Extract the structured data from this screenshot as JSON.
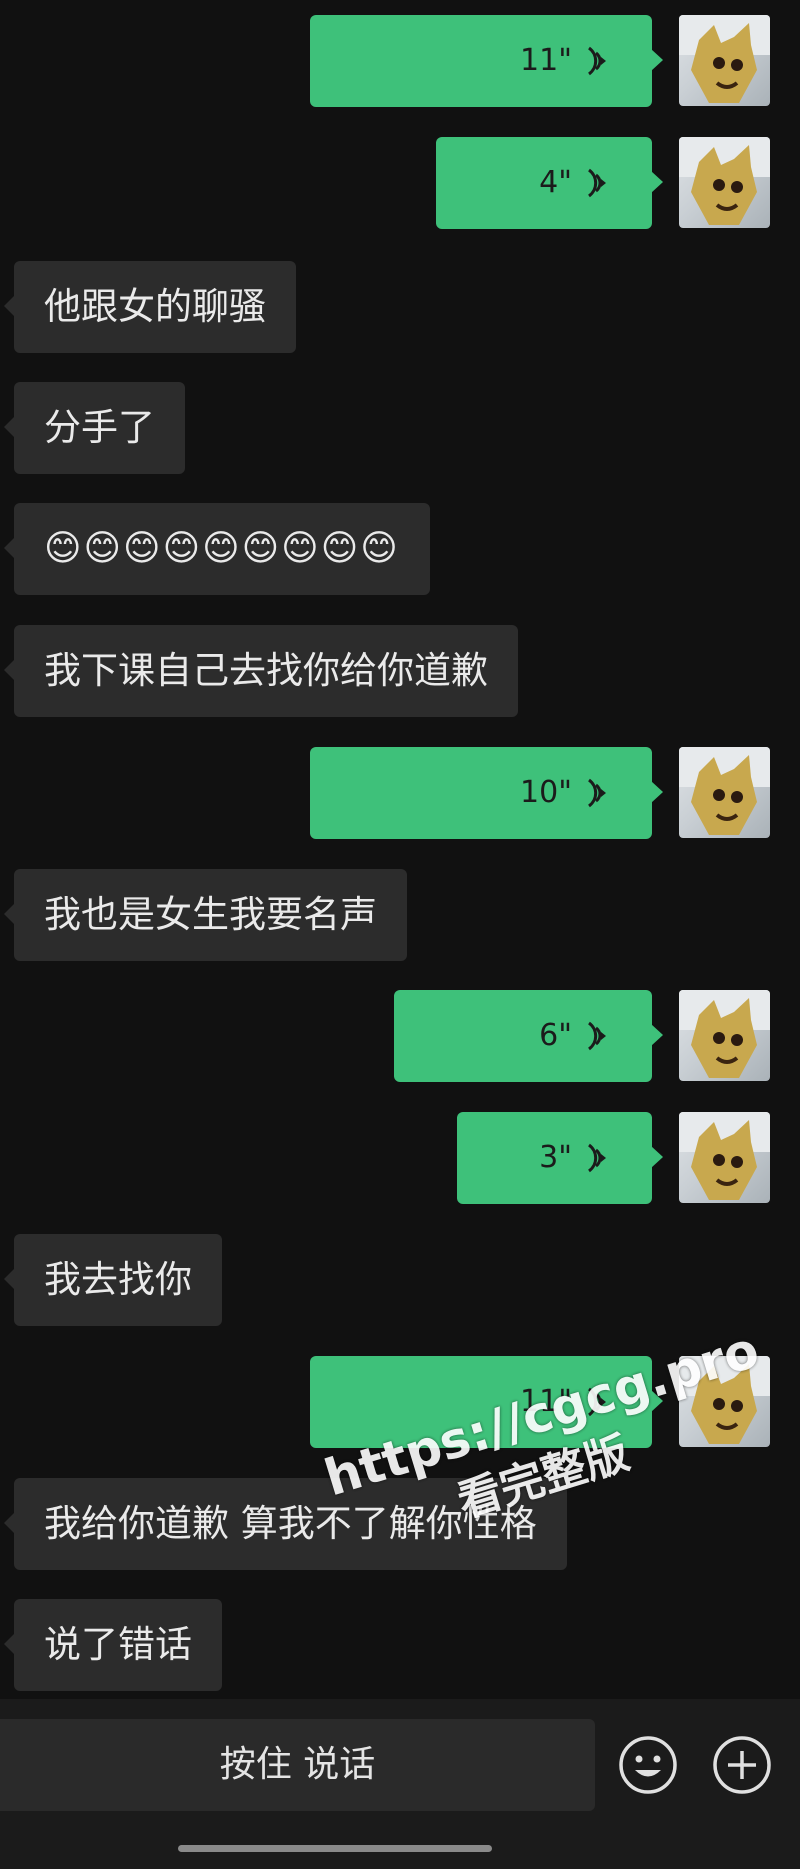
{
  "messages": [
    {
      "side": "out",
      "duration": "11\""
    },
    {
      "side": "out",
      "duration": "4\""
    },
    {
      "side": "in",
      "text": "他跟女的聊骚"
    },
    {
      "side": "in",
      "text": "分手了"
    },
    {
      "side": "in",
      "text": "😊😊😊😊😊😊😊😊😊"
    },
    {
      "side": "in",
      "text": "我下课自己去找你给你道歉"
    },
    {
      "side": "out",
      "duration": "10\""
    },
    {
      "side": "in",
      "text": "我也是女生我要名声"
    },
    {
      "side": "out",
      "duration": "6\""
    },
    {
      "side": "out",
      "duration": "3\""
    },
    {
      "side": "in",
      "text": "我去找你"
    },
    {
      "side": "out",
      "duration": "11\""
    },
    {
      "side": "in",
      "text": "我给你道歉 算我不了解你性格"
    },
    {
      "side": "in",
      "text": "说了错话"
    }
  ],
  "input_bar": {
    "press_to_talk_label": "按住 说话",
    "emoji_button_icon": "smiley-icon",
    "more_button_icon": "plus-circle-icon"
  },
  "watermark": {
    "url": "https://cgcg.pro",
    "subtitle": "看完整版"
  },
  "colors": {
    "background": "#111111",
    "incoming_bubble": "#2c2c2c",
    "outgoing_bubble": "#3ec17a"
  }
}
